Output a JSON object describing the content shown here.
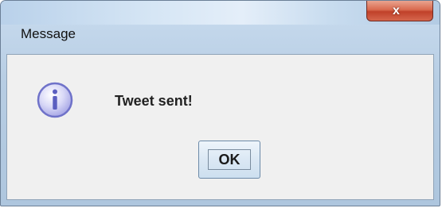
{
  "window": {
    "title": "Message"
  },
  "title_bar": {
    "close_icon": "close-icon",
    "close_glyph": "x"
  },
  "dialog": {
    "icon": "info-icon",
    "message": "Tweet sent!",
    "ok_label": "OK"
  },
  "colors": {
    "close_button": "#c94a33",
    "content_background": "#f0f0f0",
    "frame": "#b7cde3"
  }
}
